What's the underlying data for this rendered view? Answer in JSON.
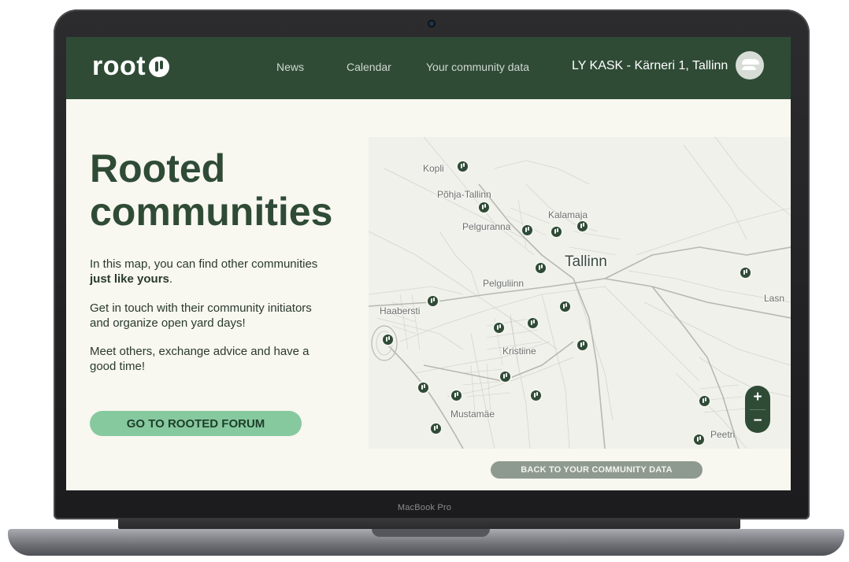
{
  "header": {
    "logo": "root",
    "nav": [
      "News",
      "Calendar",
      "Your community data"
    ],
    "community": "LY KASK - Kärneri 1, Tallinn"
  },
  "main": {
    "title_line1": "Rooted",
    "title_line2": "communities",
    "p1_text": "In this map, you can find other communities ",
    "p1_bold": "just like yours",
    "p1_end": ".",
    "p2": "Get in touch with their community initiators and organize open yard days!",
    "p3": "Meet others, exchange advice and have a good time!",
    "forum_button": "GO TO ROOTED FORUM",
    "back_button": "BACK TO YOUR COMMUNITY DATA"
  },
  "map": {
    "city": "Tallinn",
    "districts": [
      "Kopli",
      "Põhja-Tallinn",
      "Kalamaja",
      "Pelguranna",
      "Pelguliinn",
      "Haabersti",
      "Kristiine",
      "Mustamäe",
      "Peetri",
      "Lasn"
    ],
    "zoom_in": "+",
    "zoom_out": "−"
  },
  "device": {
    "brand": "MacBook Pro"
  },
  "colors": {
    "header_green": "#2f4b36",
    "button_green": "#87c99f",
    "page_bg": "#f8f7f0",
    "back_button_grey": "#8e9a90"
  }
}
